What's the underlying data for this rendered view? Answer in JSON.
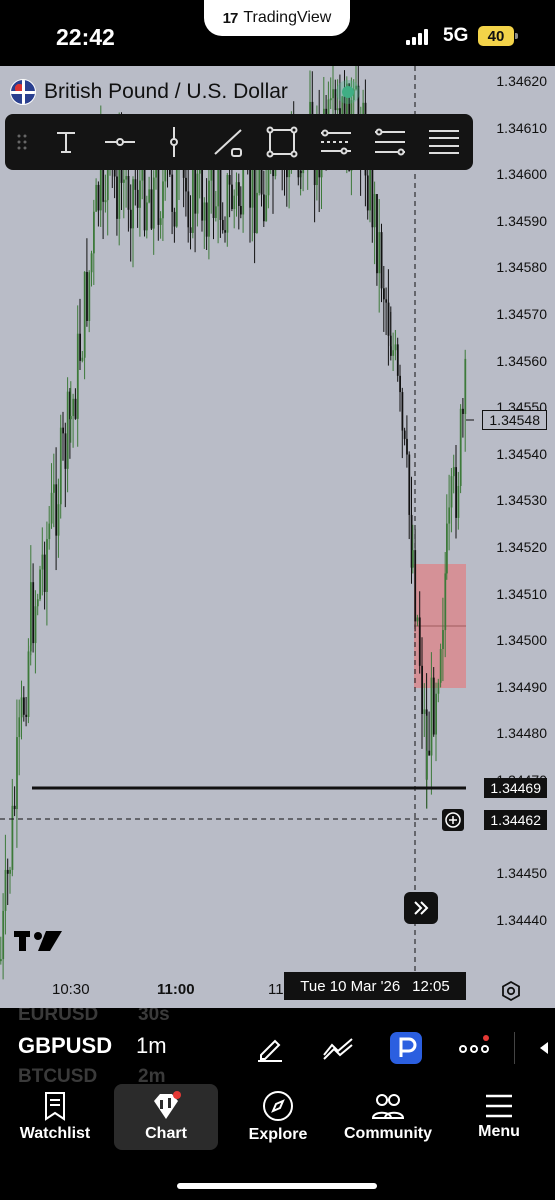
{
  "status_bar": {
    "time": "22:42",
    "app_pill": "TradingView",
    "network": "5G",
    "battery": "40"
  },
  "symbol": {
    "title": "British Pound / U.S. Dollar"
  },
  "toolbar": {
    "tools": [
      "text-tool-icon",
      "horizontal-line-icon",
      "vertical-line-icon",
      "trend-line-icon",
      "rectangle-icon",
      "parallel-channel-icon",
      "fib-retracement-icon",
      "menu-lines-icon"
    ]
  },
  "price_axis": {
    "labels": [
      "1.34620",
      "1.34610",
      "1.34600",
      "1.34590",
      "1.34580",
      "1.34570",
      "1.34560",
      "1.34550",
      "1.34540",
      "1.34530",
      "1.34520",
      "1.34510",
      "1.34500",
      "1.34490",
      "1.34480",
      "1.34470",
      "1.34450",
      "1.34440"
    ],
    "current_price": "1.34548",
    "line_price": "1.34469",
    "crosshair_price": "1.34462"
  },
  "time_axis": {
    "labels": [
      "10:30",
      "11:00",
      "11"
    ],
    "crosshair_date": "Tue 10 Mar '26",
    "crosshair_time": "12:05"
  },
  "symbol_row": {
    "prev_symbol": "EURUSD",
    "prev_interval": "30s",
    "symbol": "GBPUSD",
    "interval": "1m",
    "next_symbol": "BTCUSD",
    "next_interval": "2m"
  },
  "nav": {
    "watchlist": "Watchlist",
    "chart": "Chart",
    "explore": "Explore",
    "community": "Community",
    "menu": "Menu"
  },
  "colors": {
    "chart_bg": "#b9bcc7",
    "up_candle": "#3d7a3a",
    "down_candle": "#111111",
    "zone": "#d98a8e",
    "status_dot": "#3fae84"
  }
}
